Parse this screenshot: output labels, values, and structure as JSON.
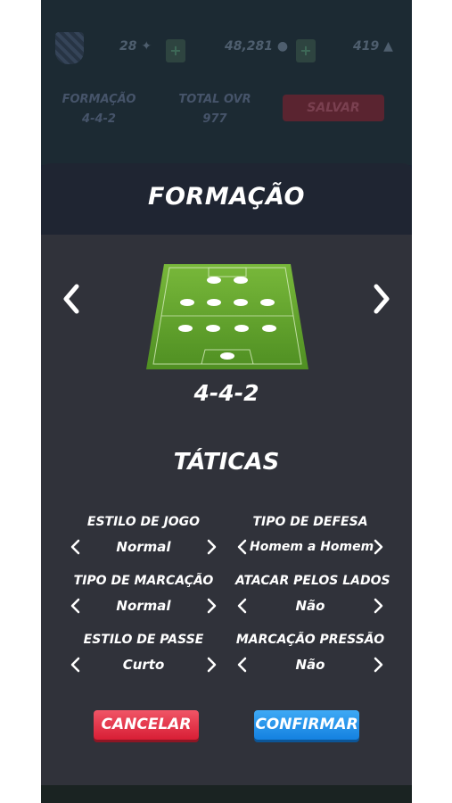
{
  "header": {
    "level": "28",
    "coins": "48,281",
    "gems": "419",
    "formation_label": "FORMAÇÃO",
    "formation_value": "4-4-2",
    "ovr_label": "TOTAL OVR",
    "ovr_value": "977",
    "save_label": "SALVAR"
  },
  "modal": {
    "title": "FORMAÇÃO",
    "formation": "4-4-2",
    "tactics_title": "TÁTICAS",
    "options": [
      {
        "label": "ESTILO DE JOGO",
        "value": "Normal"
      },
      {
        "label": "TIPO DE DEFESA",
        "value": "Homem a Homem"
      },
      {
        "label": "TIPO DE MARCAÇÃO",
        "value": "Normal"
      },
      {
        "label": "ATACAR PELOS LADOS",
        "value": "Não"
      },
      {
        "label": "ESTILO DE PASSE",
        "value": "Curto"
      },
      {
        "label": "MARCAÇÃO PRESSÃO",
        "value": "Não"
      }
    ],
    "cancel_label": "CANCELAR",
    "confirm_label": "CONFIRMAR"
  },
  "icons": {
    "prev": "chevron-left-icon",
    "next": "chevron-right-icon",
    "crest": "club-crest-icon",
    "coin": "coin-icon",
    "gem": "gem-icon"
  },
  "colors": {
    "cancel": "#e0283c",
    "confirm": "#1e8fe8",
    "pitch": "#5a9a2a"
  }
}
